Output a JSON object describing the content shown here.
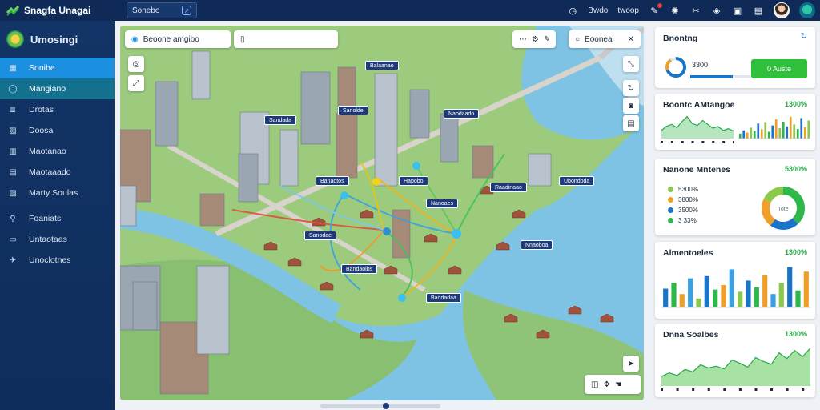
{
  "app": {
    "title": "Snagfa Unagai",
    "search_tab": "Sonebo"
  },
  "topbar": {
    "items": [
      {
        "icon": "clock-icon",
        "label": "Bwdo"
      },
      {
        "icon": "page-icon",
        "label": "twoop"
      }
    ]
  },
  "sidebar": {
    "title": "Umosingi",
    "items": [
      {
        "label": "Sonibe",
        "icon": "grid-icon"
      },
      {
        "label": "Mangiano",
        "icon": "circle-icon"
      },
      {
        "label": "Drotas",
        "icon": "list-icon"
      },
      {
        "label": "Doosa",
        "icon": "image-icon"
      },
      {
        "label": "Maotanao",
        "icon": "chart-icon"
      },
      {
        "label": "Maotaaado",
        "icon": "table-icon"
      },
      {
        "label": "Marty Soulas",
        "icon": "map-icon"
      },
      {
        "label": "Foaniats",
        "icon": "pin-icon"
      },
      {
        "label": "Untaotaas",
        "icon": "inbox-icon"
      },
      {
        "label": "Unoclotnes",
        "icon": "send-icon"
      }
    ]
  },
  "map": {
    "title_pill": "Beoone amgibo",
    "search_pill": "Eooneal",
    "pins": [
      "Balaanao",
      "Sandada",
      "Sanolde",
      "Naodaado",
      "Banadtos",
      "Raadinaao",
      "Hapobo",
      "Sanodae",
      "Nnaoboa",
      "Bandaolbs",
      "Baodadaa",
      "Ubondoda",
      "Nanoaes"
    ]
  },
  "panels": {
    "p1": {
      "title": "Bnontng",
      "value_ring": "3300",
      "button": "0 Auste",
      "progress": 0.7
    },
    "p2": {
      "title": "Boontc AMtangoe",
      "value": "1300%"
    },
    "p3": {
      "title": "Nanone Mntenes",
      "value": "5300%",
      "legend": [
        "5300%",
        "3800%",
        "3500%",
        "3 33%"
      ],
      "donut_center": "Tote",
      "donut": [
        {
          "value": 38,
          "color": "#2fb84a"
        },
        {
          "value": 22,
          "color": "#1a74c8"
        },
        {
          "value": 22,
          "color": "#f0a028"
        },
        {
          "value": 18,
          "color": "#8ac94a"
        }
      ]
    },
    "p4": {
      "title": "Almentoeles",
      "value": "1300%"
    },
    "p5": {
      "title": "Dnna Soalbes",
      "value": "1300%"
    }
  },
  "chart_data": [
    {
      "type": "area",
      "title": "Boontc AMtangoe",
      "x": [
        1,
        2,
        3,
        4,
        5,
        6,
        7,
        8,
        9,
        10,
        11,
        12,
        13,
        14,
        15
      ],
      "values": [
        30,
        45,
        52,
        40,
        62,
        80,
        55,
        48,
        66,
        52,
        38,
        44,
        30,
        36,
        28
      ]
    },
    {
      "type": "bar",
      "title": "Boontc AMtangoe",
      "categories": [
        "a",
        "b",
        "c",
        "d",
        "e",
        "f",
        "g",
        "h",
        "i",
        "j",
        "k",
        "l",
        "m",
        "n",
        "o",
        "p",
        "q",
        "r",
        "s",
        "t"
      ],
      "values": [
        18,
        30,
        22,
        40,
        28,
        55,
        34,
        60,
        25,
        48,
        70,
        38,
        62,
        45,
        80,
        52,
        35,
        75,
        42,
        66
      ]
    },
    {
      "type": "pie",
      "title": "Nanone Mntenes",
      "values": [
        38,
        22,
        22,
        18
      ]
    },
    {
      "type": "bar",
      "title": "Almentoeles",
      "categories": [
        "1",
        "2",
        "3",
        "4",
        "5",
        "6",
        "7",
        "8",
        "9",
        "10",
        "11",
        "12",
        "13",
        "14",
        "15",
        "16",
        "17",
        "18"
      ],
      "values": [
        42,
        55,
        30,
        65,
        20,
        70,
        40,
        50,
        85,
        35,
        60,
        45,
        72,
        30,
        55,
        90,
        38,
        80
      ],
      "ylim": [
        0,
        100
      ]
    },
    {
      "type": "area",
      "title": "Dnna Soalbes",
      "x": [
        1,
        2,
        3,
        4,
        5,
        6,
        7,
        8,
        9,
        10,
        11,
        12,
        13,
        14,
        15,
        16,
        17,
        18,
        19,
        20
      ],
      "values": [
        20,
        28,
        22,
        35,
        30,
        45,
        38,
        42,
        36,
        55,
        48,
        40,
        60,
        52,
        46,
        70,
        58,
        75,
        62,
        80
      ]
    }
  ]
}
